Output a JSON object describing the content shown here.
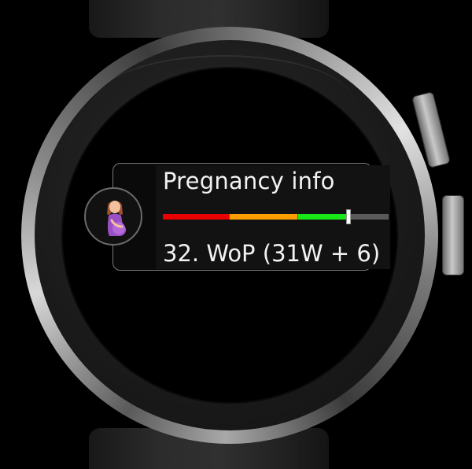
{
  "complication": {
    "title": "Pregnancy info",
    "value": "32. WoP (31W + 6)",
    "icon": "pregnant-woman-icon",
    "progress": {
      "current_week_fraction": 0.82,
      "segment_colors": [
        "#e80000",
        "#ff9e00",
        "#18e818"
      ],
      "track_color": "#5a5a5a",
      "marker_color": "#ffffff"
    }
  }
}
